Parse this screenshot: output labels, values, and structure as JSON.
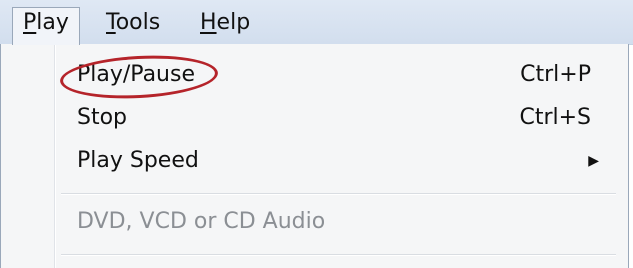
{
  "menubar": {
    "items": [
      {
        "label": "Play",
        "accel": "P",
        "active": true
      },
      {
        "label": "Tools",
        "accel": "T",
        "active": false
      },
      {
        "label": "Help",
        "accel": "H",
        "active": false
      }
    ]
  },
  "dropdown": {
    "items": [
      {
        "label": "Play/Pause",
        "shortcut": "Ctrl+P",
        "highlighted_annotation": true
      },
      {
        "label": "Stop",
        "shortcut": "Ctrl+S"
      },
      {
        "label": "Play Speed",
        "submenu": true
      },
      {
        "label": "DVD, VCD or CD Audio",
        "disabled": true
      }
    ],
    "submenu_arrow_icon": "triangle-right-icon"
  },
  "annotation": {
    "color": "#b5242a"
  }
}
